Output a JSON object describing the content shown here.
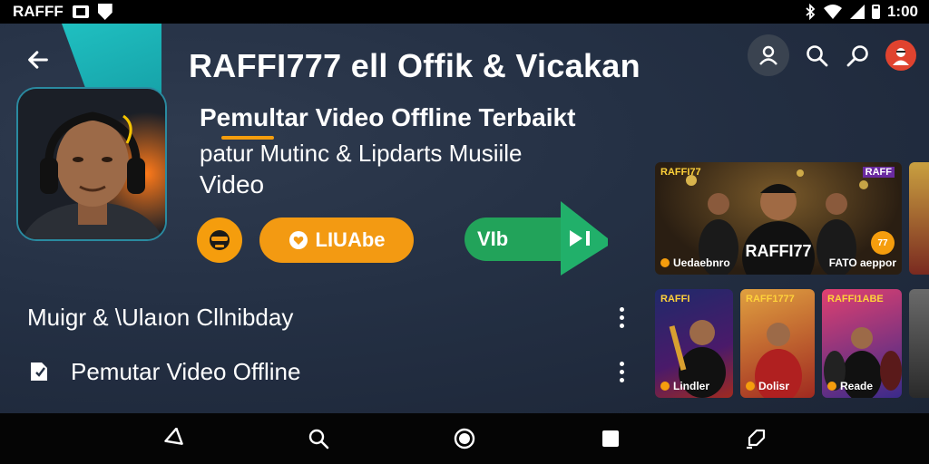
{
  "status_bar": {
    "left_text": "RAFFF",
    "right_text": "1:00"
  },
  "header": {
    "title": "RAFFI777 ell Offik & Vicakan",
    "subtitle": "Pemultar Video Offline Terbaikt",
    "desc_line1": "patur Mutinc & Lipdarts Musiile",
    "desc_line2": "Video"
  },
  "actions": {
    "orange_button_label": "LIUAbe",
    "green_button_label": "VIb"
  },
  "list": [
    {
      "label": "Muigr & \\Ulaıon Cllnibday"
    },
    {
      "label": "Pemutar Video Offline"
    }
  ],
  "thumbnails": {
    "featured": {
      "brand": "RAFFI77",
      "badge_top": "RAFF",
      "name": "RAFFI77",
      "caption_left": "Uedaebnro",
      "caption_right": "FATO aeppor",
      "badge": "77"
    },
    "small": [
      {
        "brand": "RAFFI",
        "caption": "Lindler"
      },
      {
        "brand": "RAFF1777",
        "caption": "Dolisr"
      },
      {
        "brand": "RAFFI1ABE",
        "caption": "Reade"
      }
    ]
  },
  "icons": {
    "back": "arrow-left-icon",
    "profile": "user-icon",
    "search": "search-icon",
    "chat": "chat-search-icon",
    "avatar": "avatar-icon"
  },
  "colors": {
    "accent_orange": "#f39a12",
    "accent_green": "#22a35a",
    "teal": "#1fc7c7",
    "background": "#243044"
  }
}
